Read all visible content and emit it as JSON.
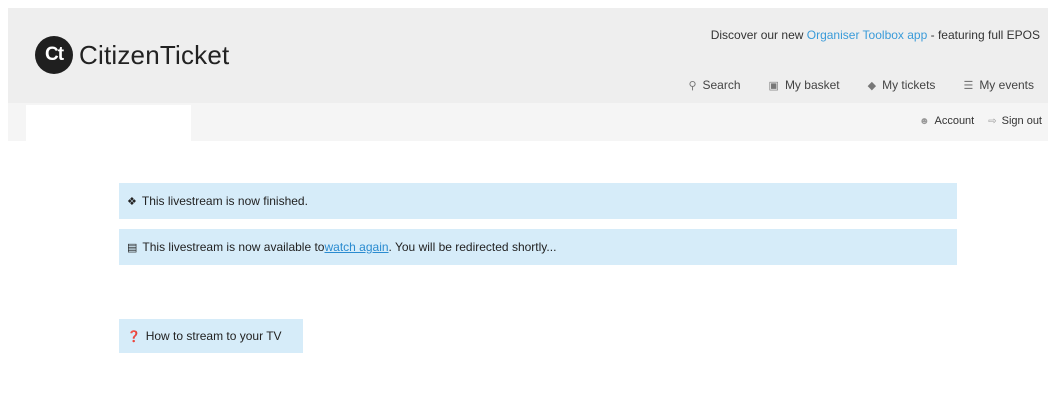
{
  "brand": {
    "logo_mark": "Ct",
    "name": "CitizenTicket"
  },
  "promo": {
    "prefix": "Discover our new ",
    "link": "Organiser Toolbox app",
    "suffix": " - featuring full EPOS"
  },
  "topnav": {
    "items": [
      {
        "icon": "search-icon",
        "label": "Search"
      },
      {
        "icon": "basket-icon",
        "label": "My basket"
      },
      {
        "icon": "ticket-icon",
        "label": "My tickets"
      },
      {
        "icon": "events-icon",
        "label": "My events"
      }
    ]
  },
  "accountnav": {
    "items": [
      {
        "icon": "user-icon",
        "label": "Account"
      },
      {
        "icon": "sign-out-icon",
        "label": "Sign out"
      }
    ]
  },
  "alerts": {
    "finished": {
      "icon": "info-circle-icon",
      "text": "This livestream is now finished."
    },
    "available": {
      "icon": "film-icon",
      "prefix": "This livestream is now available to ",
      "link": "watch again",
      "suffix": ". You will be redirected shortly..."
    },
    "help": {
      "icon": "question-circle-icon",
      "text": "How to stream to your TV"
    }
  },
  "colors": {
    "alert_bg": "#d6ecf9",
    "link": "#2a8bd0",
    "header_bg": "#eeeeee"
  }
}
